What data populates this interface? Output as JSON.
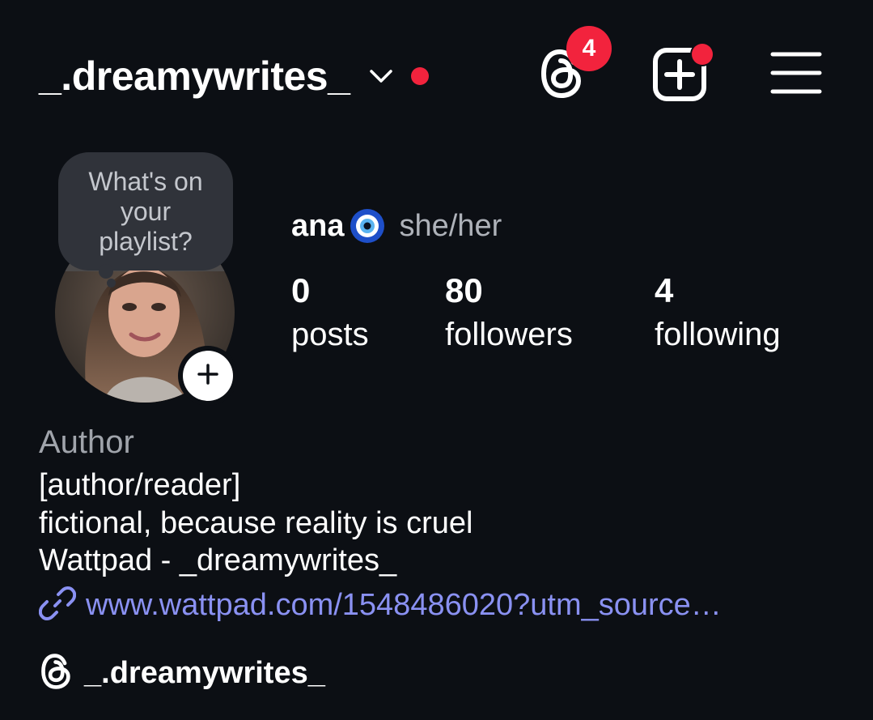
{
  "colors": {
    "background": "#0c0f14",
    "notification_red": "#f2233d",
    "link": "#8a91f2",
    "muted_text": "#aeb2b9",
    "bubble": "#30333a"
  },
  "header": {
    "username": "_.dreamywrites_",
    "switch_account_icon": "chevron-down-icon",
    "account_notification_dot": true,
    "threads_icon": "threads-icon",
    "threads_badge": "4",
    "create_icon": "plus-square-icon",
    "create_notification_dot": true,
    "menu_icon": "hamburger-menu-icon"
  },
  "profile": {
    "note_bubble": "What's on your playlist?",
    "avatar_icon": "profile-photo",
    "add_story_icon": "plus-icon",
    "display_name": "ana",
    "name_emoji_icon": "nazar-evil-eye-icon",
    "pronouns": "she/her",
    "stats": {
      "posts": {
        "value": "0",
        "label": "posts"
      },
      "followers": {
        "value": "80",
        "label": "followers"
      },
      "following": {
        "value": "4",
        "label": "following"
      }
    }
  },
  "bio": {
    "category": "Author",
    "lines": [
      "[author/reader]",
      "fictional, because reality is cruel",
      "Wattpad - _dreamywrites_"
    ],
    "link_icon": "link-icon",
    "link": "www.wattpad.com/1548486020?utm_source…",
    "threads_icon": "threads-icon",
    "threads_handle": "_.dreamywrites_"
  }
}
